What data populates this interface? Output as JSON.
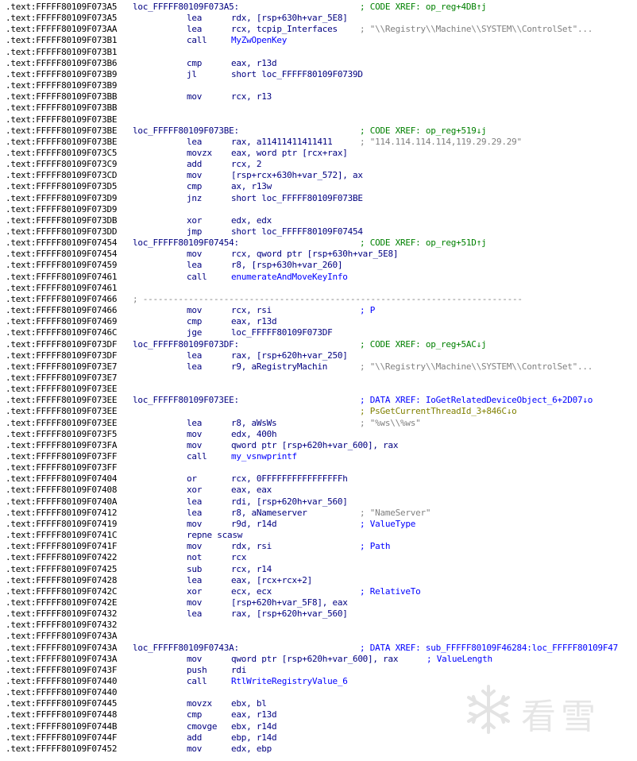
{
  "listing": [
    {
      "addr": ".text:FFFFF80109F073A5",
      "label": "loc_FFFFF80109F073A5:",
      "xref": "; CODE XREF: op_reg+4DB↑j",
      "xref_type": "code"
    },
    {
      "addr": ".text:FFFFF80109F073A5",
      "mnem": "lea",
      "ops": "rdx, [rsp+630h+var_5E8]"
    },
    {
      "addr": ".text:FFFFF80109F073AA",
      "mnem": "lea",
      "ops": "rcx, tcpip_Interfaces",
      "comment": "; \"\\\\Registry\\\\Machine\\\\SYSTEM\\\\ControlSet\"...",
      "comment_type": "str"
    },
    {
      "addr": ".text:FFFFF80109F073B1",
      "mnem": "call",
      "ops": "MyZwOpenKey",
      "ops_type": "sym"
    },
    {
      "addr": ".text:FFFFF80109F073B1"
    },
    {
      "addr": ".text:FFFFF80109F073B6",
      "mnem": "cmp",
      "ops": "eax, r13d"
    },
    {
      "addr": ".text:FFFFF80109F073B9",
      "mnem": "jl",
      "ops": "short loc_FFFFF80109F0739D"
    },
    {
      "addr": ".text:FFFFF80109F073B9"
    },
    {
      "addr": ".text:FFFFF80109F073BB",
      "mnem": "mov",
      "ops": "rcx, r13"
    },
    {
      "addr": ".text:FFFFF80109F073BB"
    },
    {
      "addr": ".text:FFFFF80109F073BE"
    },
    {
      "addr": ".text:FFFFF80109F073BE",
      "label": "loc_FFFFF80109F073BE:",
      "xref": "; CODE XREF: op_reg+519↓j",
      "xref_type": "code"
    },
    {
      "addr": ".text:FFFFF80109F073BE",
      "mnem": "lea",
      "ops": "rax, a11411411411411",
      "comment": "; \"114.114.114.114,119.29.29.29\"",
      "comment_type": "str"
    },
    {
      "addr": ".text:FFFFF80109F073C5",
      "mnem": "movzx",
      "ops": "eax, word ptr [rcx+rax]"
    },
    {
      "addr": ".text:FFFFF80109F073C9",
      "mnem": "add",
      "ops": "rcx, 2"
    },
    {
      "addr": ".text:FFFFF80109F073CD",
      "mnem": "mov",
      "ops": "[rsp+rcx+630h+var_572], ax"
    },
    {
      "addr": ".text:FFFFF80109F073D5",
      "mnem": "cmp",
      "ops": "ax, r13w"
    },
    {
      "addr": ".text:FFFFF80109F073D9",
      "mnem": "jnz",
      "ops": "short loc_FFFFF80109F073BE"
    },
    {
      "addr": ".text:FFFFF80109F073D9"
    },
    {
      "addr": ".text:FFFFF80109F073DB",
      "mnem": "xor",
      "ops": "edx, edx"
    },
    {
      "addr": ".text:FFFFF80109F073DD",
      "mnem": "jmp",
      "ops": "short loc_FFFFF80109F07454"
    },
    {
      "addr": ".text:FFFFF80109F07454",
      "label": "loc_FFFFF80109F07454:",
      "xref": "; CODE XREF: op_reg+51D↑j",
      "xref_type": "code"
    },
    {
      "addr": ".text:FFFFF80109F07454",
      "mnem": "mov",
      "ops": "rcx, qword ptr [rsp+630h+var_5E8]"
    },
    {
      "addr": ".text:FFFFF80109F07459",
      "mnem": "lea",
      "ops": "r8, [rsp+630h+var_260]"
    },
    {
      "addr": ".text:FFFFF80109F07461",
      "mnem": "call",
      "ops": "enumerateAndMoveKeyInfo",
      "ops_type": "sym"
    },
    {
      "addr": ".text:FFFFF80109F07461"
    },
    {
      "addr": ".text:FFFFF80109F07466",
      "sep": "; ---------------------------------------------------------------------------"
    },
    {
      "addr": ".text:FFFFF80109F07466",
      "mnem": "mov",
      "ops": "rcx, rsi",
      "comment": "; P",
      "comment_type": "arg"
    },
    {
      "addr": ".text:FFFFF80109F07469",
      "mnem": "cmp",
      "ops": "eax, r13d"
    },
    {
      "addr": ".text:FFFFF80109F0746C",
      "mnem": "jge",
      "ops": "loc_FFFFF80109F073DF"
    },
    {
      "addr": ".text:FFFFF80109F073DF",
      "label": "loc_FFFFF80109F073DF:",
      "xref": "; CODE XREF: op_reg+5AC↓j",
      "xref_type": "code"
    },
    {
      "addr": ".text:FFFFF80109F073DF",
      "mnem": "lea",
      "ops": "rax, [rsp+620h+var_250]"
    },
    {
      "addr": ".text:FFFFF80109F073E7",
      "mnem": "lea",
      "ops": "r9, aRegistryMachin",
      "comment": "; \"\\\\Registry\\\\Machine\\\\SYSTEM\\\\ControlSet\"...",
      "comment_type": "str"
    },
    {
      "addr": ".text:FFFFF80109F073E7"
    },
    {
      "addr": ".text:FFFFF80109F073EE"
    },
    {
      "addr": ".text:FFFFF80109F073EE",
      "label": "loc_FFFFF80109F073EE:",
      "xref": "; DATA XREF: IoGetRelatedDeviceObject_6+2D07↓o",
      "xref_type": "data"
    },
    {
      "addr": ".text:FFFFF80109F073EE",
      "xref": "; PsGetCurrentThreadId_3+846C↓o",
      "xref_type": "data2"
    },
    {
      "addr": ".text:FFFFF80109F073EE",
      "mnem": "lea",
      "ops": "r8, aWsWs",
      "comment": "; \"%ws\\\\%ws\"",
      "comment_type": "str"
    },
    {
      "addr": ".text:FFFFF80109F073F5",
      "mnem": "mov",
      "ops": "edx, 400h",
      "ops_type": "num"
    },
    {
      "addr": ".text:FFFFF80109F073FA",
      "mnem": "mov",
      "ops": "qword ptr [rsp+620h+var_600], rax"
    },
    {
      "addr": ".text:FFFFF80109F073FF",
      "mnem": "call",
      "ops": "my_vsnwprintf",
      "ops_type": "sym"
    },
    {
      "addr": ".text:FFFFF80109F073FF"
    },
    {
      "addr": ".text:FFFFF80109F07404",
      "mnem": "or",
      "ops": "rcx, 0FFFFFFFFFFFFFFFFh",
      "ops_type": "num"
    },
    {
      "addr": ".text:FFFFF80109F07408",
      "mnem": "xor",
      "ops": "eax, eax"
    },
    {
      "addr": ".text:FFFFF80109F0740A",
      "mnem": "lea",
      "ops": "rdi, [rsp+620h+var_560]"
    },
    {
      "addr": ".text:FFFFF80109F07412",
      "mnem": "lea",
      "ops": "r8, aNameserver",
      "comment": "; \"NameServer\"",
      "comment_type": "str"
    },
    {
      "addr": ".text:FFFFF80109F07419",
      "mnem": "mov",
      "ops": "r9d, r14d",
      "comment": "; ValueType",
      "comment_type": "arg"
    },
    {
      "addr": ".text:FFFFF80109F0741C",
      "mnem": "repne scasw"
    },
    {
      "addr": ".text:FFFFF80109F0741F",
      "mnem": "mov",
      "ops": "rdx, rsi",
      "comment": "; Path",
      "comment_type": "arg"
    },
    {
      "addr": ".text:FFFFF80109F07422",
      "mnem": "not",
      "ops": "rcx"
    },
    {
      "addr": ".text:FFFFF80109F07425",
      "mnem": "sub",
      "ops": "rcx, r14"
    },
    {
      "addr": ".text:FFFFF80109F07428",
      "mnem": "lea",
      "ops": "eax, [rcx+rcx+2]"
    },
    {
      "addr": ".text:FFFFF80109F0742C",
      "mnem": "xor",
      "ops": "ecx, ecx",
      "comment": "; RelativeTo",
      "comment_type": "arg"
    },
    {
      "addr": ".text:FFFFF80109F0742E",
      "mnem": "mov",
      "ops": "[rsp+620h+var_5F8], eax"
    },
    {
      "addr": ".text:FFFFF80109F07432",
      "mnem": "lea",
      "ops": "rax, [rsp+620h+var_560]"
    },
    {
      "addr": ".text:FFFFF80109F07432"
    },
    {
      "addr": ".text:FFFFF80109F0743A"
    },
    {
      "addr": ".text:FFFFF80109F0743A",
      "label": "loc_FFFFF80109F0743A:",
      "xref": "; DATA XREF: sub_FFFFF80109F46284:loc_FFFFF80109F47",
      "xref_type": "data"
    },
    {
      "addr": ".text:FFFFF80109F0743A",
      "mnem": "mov",
      "ops": "qword ptr [rsp+620h+var_600], rax",
      "comment": "; ValueLength",
      "comment_type": "arg_inline"
    },
    {
      "addr": ".text:FFFFF80109F0743F",
      "mnem": "push",
      "ops": "rdi"
    },
    {
      "addr": ".text:FFFFF80109F07440",
      "mnem": "call",
      "ops": "RtlWriteRegistryValue_6",
      "ops_type": "sym"
    },
    {
      "addr": ".text:FFFFF80109F07440"
    },
    {
      "addr": ".text:FFFFF80109F07445",
      "mnem": "movzx",
      "ops": "ebx, bl"
    },
    {
      "addr": ".text:FFFFF80109F07448",
      "mnem": "cmp",
      "ops": "eax, r13d"
    },
    {
      "addr": ".text:FFFFF80109F0744B",
      "mnem": "cmovge",
      "ops": "ebx, r14d"
    },
    {
      "addr": ".text:FFFFF80109F0744F",
      "mnem": "add",
      "ops": "ebp, r14d"
    },
    {
      "addr": ".text:FFFFF80109F07452",
      "mnem": "mov",
      "ops": "edx, ebp"
    }
  ],
  "watermark": {
    "text": "看雪",
    "icon": "snowflake-logo"
  },
  "colors": {
    "background": "#ffffff",
    "address": "#000000",
    "code": "#000080",
    "string_comment": "#808080",
    "code_xref": "#008000",
    "data_xref": "#0000ff",
    "data_xref_secondary": "#808000"
  }
}
